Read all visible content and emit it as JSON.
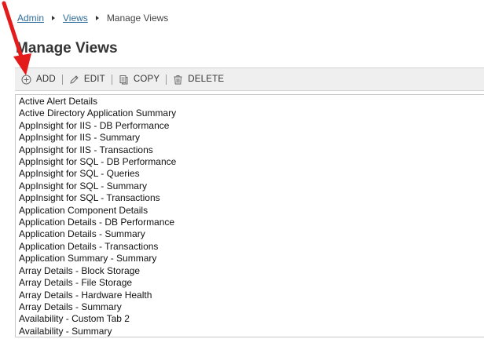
{
  "breadcrumb": {
    "items": [
      "Admin",
      "Views"
    ],
    "current": "Manage Views"
  },
  "page": {
    "title": "Manage Views"
  },
  "toolbar": {
    "add_label": "ADD",
    "edit_label": "EDIT",
    "copy_label": "COPY",
    "delete_label": "DELETE"
  },
  "views_list": {
    "items": [
      "Active Alert Details",
      "Active Directory Application Summary",
      "AppInsight for IIS - DB Performance",
      "AppInsight for IIS - Summary",
      "AppInsight for IIS - Transactions",
      "AppInsight for SQL - DB Performance",
      "AppInsight for SQL - Queries",
      "AppInsight for SQL - Summary",
      "AppInsight for SQL - Transactions",
      "Application Component Details",
      "Application Details - DB Performance",
      "Application Details - Summary",
      "Application Details - Transactions",
      "Application Summary - Summary",
      "Array Details - Block Storage",
      "Array Details - File Storage",
      "Array Details - Hardware Health",
      "Array Details - Summary",
      "Availability - Custom Tab 2",
      "Availability - Summary"
    ]
  },
  "colors": {
    "link": "#2f6d9a",
    "toolbar_bg": "#efefef",
    "annotation_arrow": "#e31b1b"
  },
  "icons": {
    "add": "plus-circle-icon",
    "edit": "pencil-icon",
    "copy": "copy-icon",
    "delete": "trash-icon",
    "breadcrumb_separator": "caret-right-icon"
  }
}
